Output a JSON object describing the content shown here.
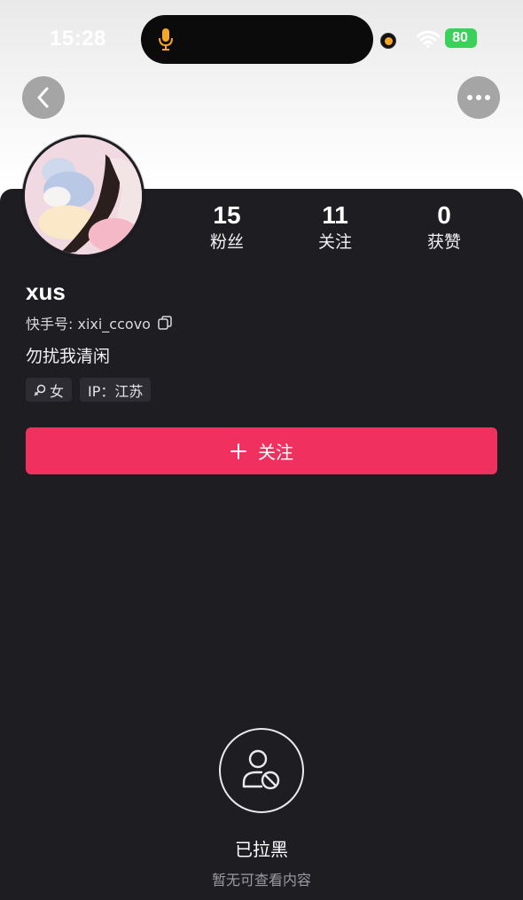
{
  "status_bar": {
    "time": "15:28",
    "battery": "80",
    "icons": [
      "microphone-icon",
      "wifi-icon",
      "battery-icon",
      "recording-dot"
    ]
  },
  "nav": {
    "back_icon": "chevron-left-icon",
    "more_icon": "more-dots-icon"
  },
  "profile": {
    "stats": [
      {
        "value": "15",
        "label": "粉丝"
      },
      {
        "value": "11",
        "label": "关注"
      },
      {
        "value": "0",
        "label": "获赞"
      }
    ],
    "username": "xus",
    "kuaishou_id": "快手号: xixi_ccovo",
    "bio": "勿扰我清闲",
    "tags": {
      "gender": "女",
      "ip": "IP：江苏"
    },
    "follow_button": "关注"
  },
  "blocked": {
    "title": "已拉黑",
    "subtitle": "暂无可查看内容"
  },
  "colors": {
    "card_bg": "#1e1d22",
    "accent": "#f0305e",
    "battery": "#3ad15a"
  }
}
